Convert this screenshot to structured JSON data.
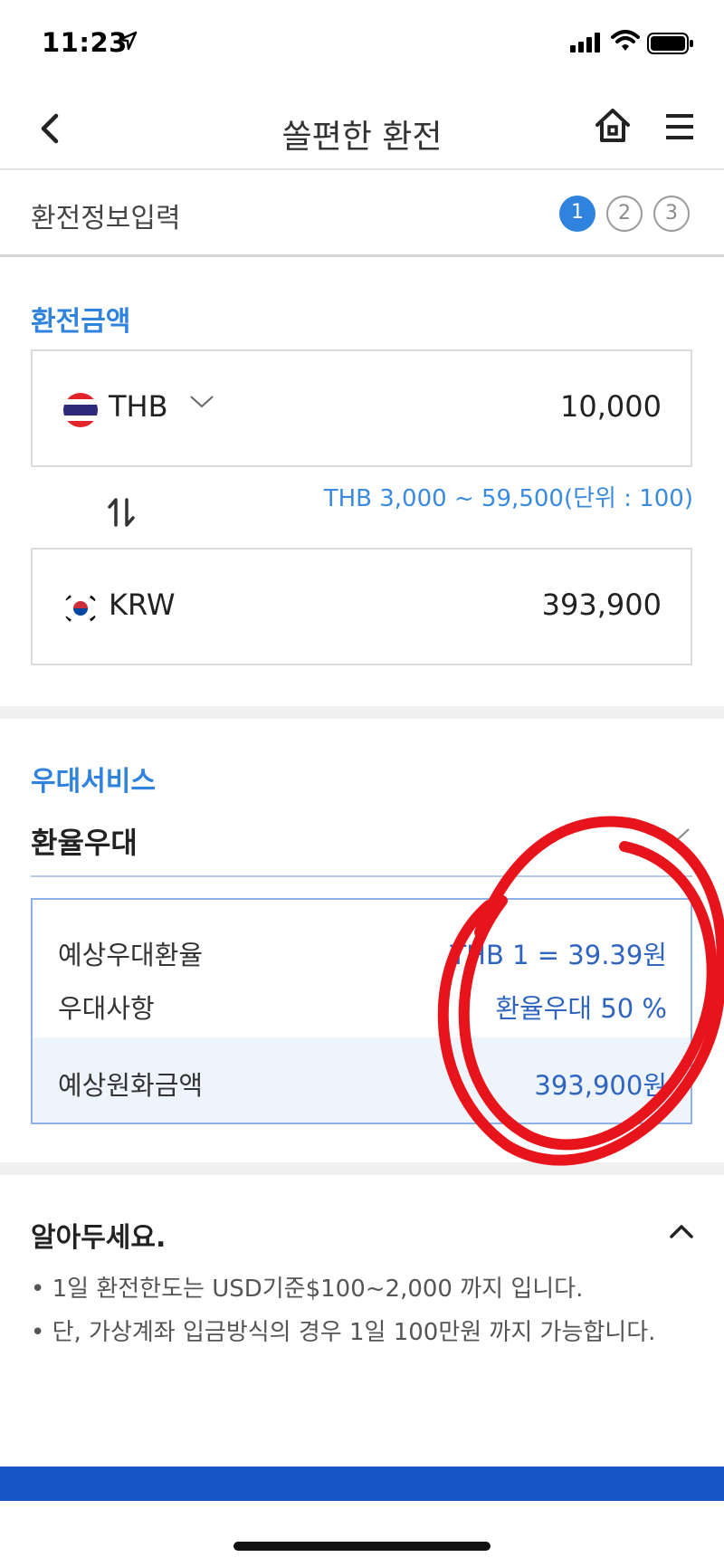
{
  "status": {
    "time": "11:23"
  },
  "header": {
    "title": "쏠편한 환전"
  },
  "steps": {
    "label": "환전정보입력",
    "items": [
      "1",
      "2",
      "3"
    ],
    "active": 1
  },
  "exchange": {
    "section_title": "환전금액",
    "from": {
      "currency": "THB",
      "amount": "10,000"
    },
    "range_hint": "THB 3,000 ~ 59,500(단위 : 100)",
    "to": {
      "currency": "KRW",
      "amount": "393,900"
    }
  },
  "benefit": {
    "section_title": "우대서비스",
    "name": "환율우대",
    "rows": [
      {
        "label": "예상우대환율",
        "value": "THB 1 = 39.39원"
      },
      {
        "label": "우대사항",
        "value": "환율우대 50 %"
      },
      {
        "label": "예상원화금액",
        "value": "393,900원"
      }
    ]
  },
  "notice": {
    "title": "알아두세요.",
    "items": [
      "• 1일 환전한도는 USD기준$100~2,000 까지 입니다.",
      "• 단, 가상계좌 입금방식의 경우 1일 100만원 까지 가능합니다."
    ]
  },
  "colors": {
    "accent": "#2f82de",
    "value_blue": "#2f64c0",
    "annotation_red": "#e8141c",
    "button_blue": "#1756c4"
  }
}
